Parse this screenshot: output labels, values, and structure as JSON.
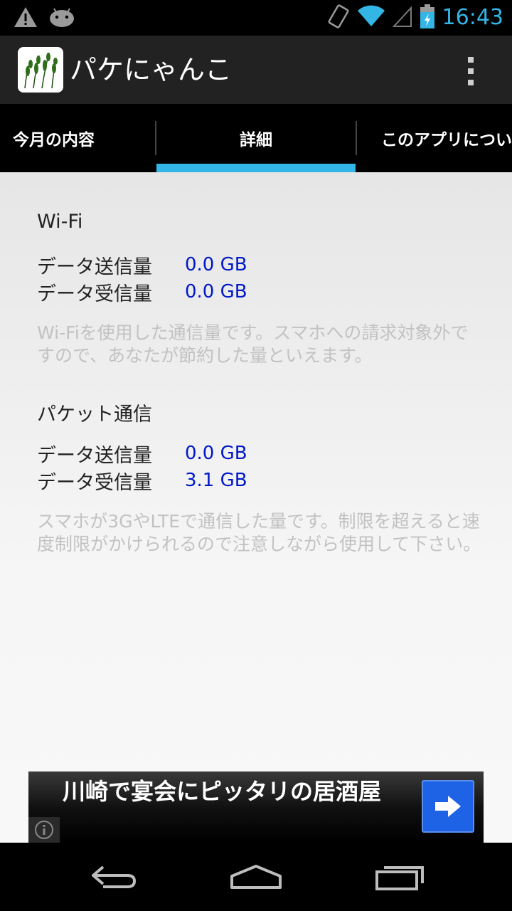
{
  "status_bar": {
    "time": "16:43",
    "icons": [
      "warning-icon",
      "android-icon",
      "rotation-icon",
      "wifi-icon",
      "signal-icon",
      "battery-charging-icon"
    ]
  },
  "action_bar": {
    "title": "パケにゃんこ",
    "icon": "app-logo-icon",
    "menu_icon": "overflow-menu-icon"
  },
  "tabs": [
    {
      "label": "今月の内容",
      "selected": false
    },
    {
      "label": "詳細",
      "selected": true
    },
    {
      "label": "このアプリについて",
      "selected": false
    }
  ],
  "wifi": {
    "title": "Wi-Fi",
    "send_label": "データ送信量",
    "send_value": "0.0 GB",
    "recv_label": "データ受信量",
    "recv_value": "0.0 GB",
    "note": "Wi-Fiを使用した通信量です。スマホへの請求対象外ですので、あなたが節約した量といえます。"
  },
  "packet": {
    "title": "パケット通信",
    "send_label": "データ送信量",
    "send_value": "0.0 GB",
    "recv_label": "データ受信量",
    "recv_value": "3.1 GB",
    "note": "スマホが3GやLTEで通信した量です。制限を超えると速度制限がかけられるので注意しながら使用して下さい。"
  },
  "ad": {
    "text": "川崎で宴会にピッタリの居酒屋",
    "info_icon": "info-icon",
    "arrow_icon": "arrow-right-icon"
  },
  "nav_bar": {
    "icons": [
      "back-icon",
      "home-icon",
      "recent-apps-icon"
    ]
  },
  "colors": {
    "accent": "#33b5e5",
    "value_text": "#0018c8",
    "note_text": "#c2c2c2",
    "action_bar": "#222222"
  }
}
